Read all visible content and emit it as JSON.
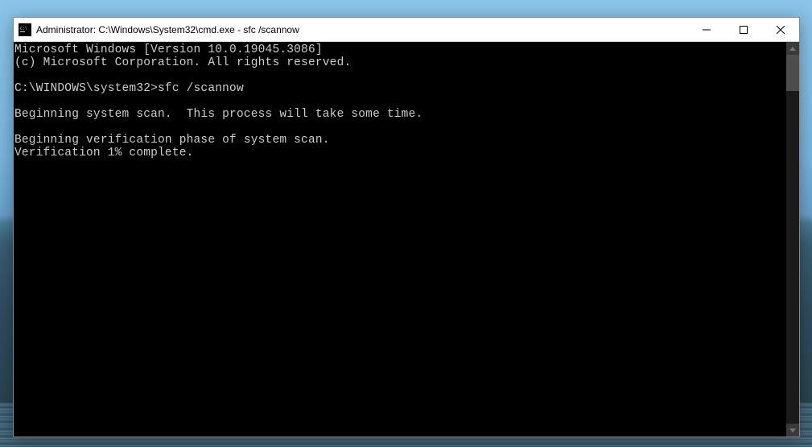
{
  "titlebar": {
    "title": "Administrator: C:\\Windows\\System32\\cmd.exe - sfc  /scannow"
  },
  "console": {
    "lines": [
      "Microsoft Windows [Version 10.0.19045.3086]",
      "(c) Microsoft Corporation. All rights reserved.",
      "",
      "C:\\WINDOWS\\system32>sfc /scannow",
      "",
      "Beginning system scan.  This process will take some time.",
      "",
      "Beginning verification phase of system scan.",
      "Verification 1% complete."
    ]
  }
}
